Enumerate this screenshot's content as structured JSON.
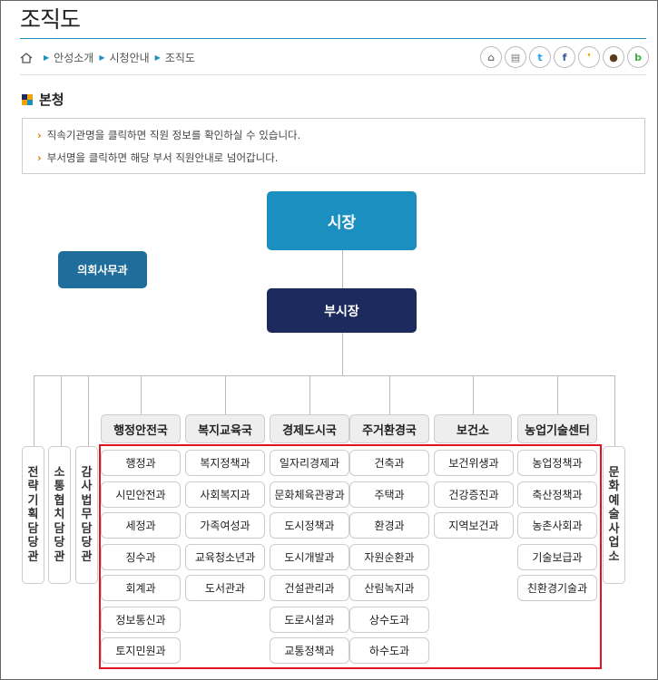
{
  "page": {
    "title": "조직도",
    "breadcrumb": [
      "안성소개",
      "시청안내",
      "조직도"
    ],
    "share_buttons": [
      {
        "icon": "scrap-icon",
        "glyph": "⌂",
        "color": "#777"
      },
      {
        "icon": "print-icon",
        "glyph": "▤",
        "color": "#777"
      },
      {
        "icon": "twitter-icon",
        "glyph": "t",
        "color": "#1da1f2"
      },
      {
        "icon": "facebook-icon",
        "glyph": "f",
        "color": "#3b5998"
      },
      {
        "icon": "kakaostory-icon",
        "glyph": "❜",
        "color": "#f5a300"
      },
      {
        "icon": "kakaotalk-icon",
        "glyph": "●",
        "color": "#5a3a1a"
      },
      {
        "icon": "band-icon",
        "glyph": "b",
        "color": "#3cb043"
      }
    ]
  },
  "section": {
    "title": "본청",
    "notices": [
      "직속기관명을 클릭하면 직원 정보를 확인하실 수 있습니다.",
      "부서명을 클릭하면 해당 부서 직원안내로 넘어갑니다."
    ]
  },
  "org": {
    "mayor": "시장",
    "vice_mayor": "부시장",
    "council_office": "의회사무과",
    "left_officers": [
      {
        "label": "전략기획담당관",
        "chars": [
          "전",
          "략",
          "기",
          "획",
          "담",
          "당",
          "관"
        ]
      },
      {
        "label": "소통협치담당관",
        "chars": [
          "소",
          "통",
          "협",
          "치",
          "담",
          "당",
          "관"
        ]
      },
      {
        "label": "감사법무담당관",
        "chars": [
          "감",
          "사",
          "법",
          "무",
          "담",
          "당",
          "관"
        ]
      }
    ],
    "right_office": {
      "label": "문화예술사업소",
      "chars": [
        "문",
        "화",
        "예",
        "술",
        "사",
        "업",
        "소"
      ]
    },
    "departments": [
      {
        "name": "행정안전국",
        "units": [
          "행정과",
          "시민안전과",
          "세정과",
          "징수과",
          "회계과",
          "정보통신과",
          "토지민원과"
        ]
      },
      {
        "name": "복지교육국",
        "units": [
          "복지정책과",
          "사회복지과",
          "가족여성과",
          "교육청소년과",
          "도서관과"
        ]
      },
      {
        "name": "경제도시국",
        "units": [
          "일자리경제과",
          "문화체육관광과",
          "도시정책과",
          "도시개발과",
          "건설관리과",
          "도로시설과",
          "교통정책과"
        ]
      },
      {
        "name": "주거환경국",
        "units": [
          "건축과",
          "주택과",
          "환경과",
          "자원순환과",
          "산림녹지과",
          "상수도과",
          "하수도과"
        ]
      },
      {
        "name": "보건소",
        "units": [
          "보건위생과",
          "건강증진과",
          "지역보건과"
        ]
      },
      {
        "name": "농업기술센터",
        "units": [
          "농업정책과",
          "축산정책과",
          "농촌사회과",
          "기술보급과",
          "친환경기술과"
        ]
      }
    ]
  },
  "colors": {
    "mayor": "#1a8fc0",
    "vice_mayor": "#1d2a5e",
    "council": "#1f6d9a",
    "highlight_border": "#e0141e"
  }
}
